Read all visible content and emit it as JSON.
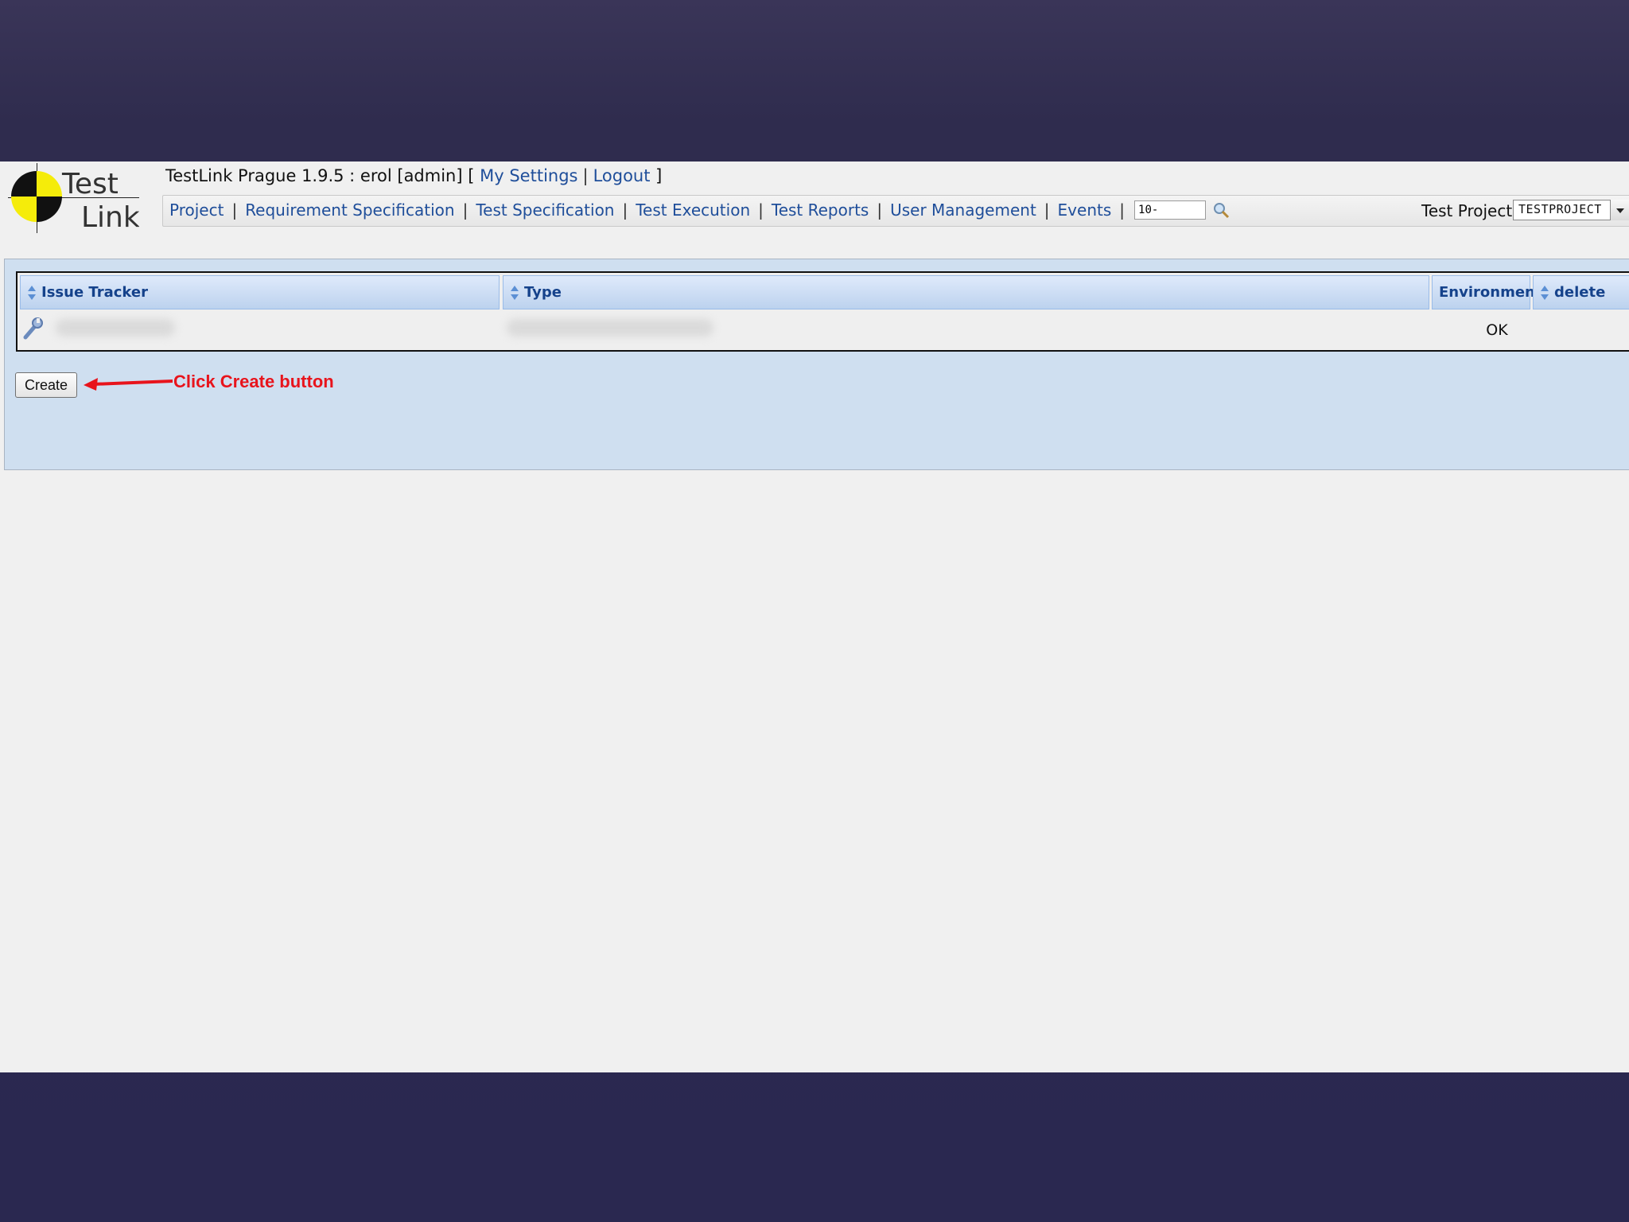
{
  "app": {
    "title": "TestLink Prague 1.9.5 : erol [admin] [",
    "close_bracket": "]",
    "my_settings": "My Settings",
    "logout": "Logout"
  },
  "logo": {
    "line1": "Test",
    "line2": "Link"
  },
  "nav": {
    "items": [
      "Project",
      "Requirement Specification",
      "Test Specification",
      "Test Execution",
      "Test Reports",
      "User Management",
      "Events"
    ],
    "search_value": "10-",
    "project_label": "Test Project",
    "project_selected": "TESTPROJECT"
  },
  "table": {
    "headers": {
      "issue_tracker": "Issue Tracker",
      "type": "Type",
      "environment": "Environment",
      "delete": "delete"
    },
    "rows": [
      {
        "environment": "OK"
      }
    ]
  },
  "actions": {
    "create_label": "Create"
  },
  "annotation": {
    "text": "Click Create button",
    "color": "#e8141c"
  }
}
